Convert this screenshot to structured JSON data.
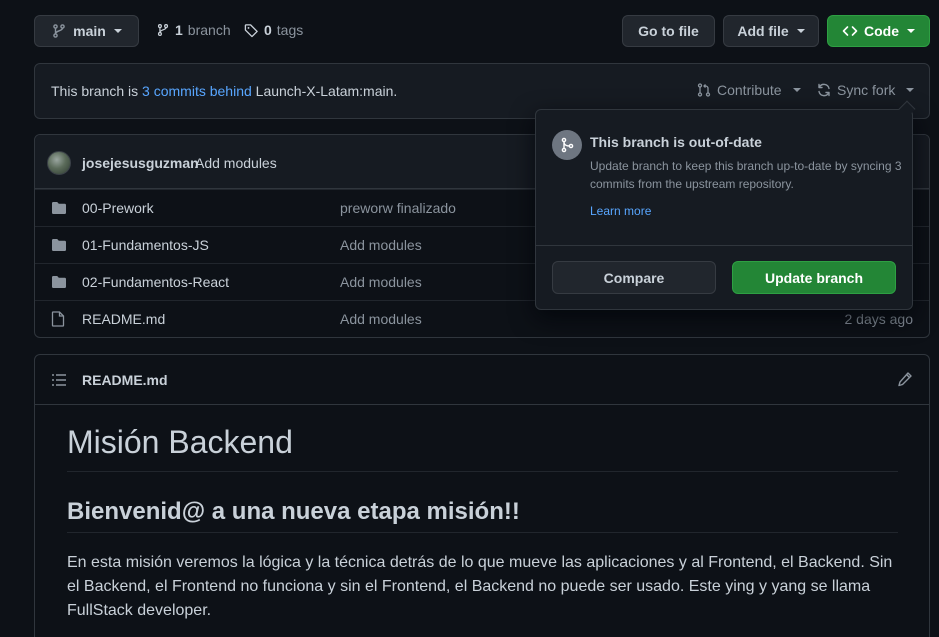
{
  "toolbar": {
    "branch_name": "main",
    "branch_count": "1",
    "branch_label": "branch",
    "tag_count": "0",
    "tag_label": "tags",
    "go_to_file": "Go to file",
    "add_file": "Add file",
    "code": "Code"
  },
  "banner": {
    "prefix": "This branch is",
    "link": "3 commits behind",
    "suffix": "Launch-X-Latam:main.",
    "contribute": "Contribute",
    "sync_fork": "Sync fork"
  },
  "commit": {
    "author": "josejesusguzman",
    "message": "Add modules"
  },
  "files": [
    {
      "type": "folder",
      "name": "00-Prework",
      "commit": "preworw finalizado",
      "date": ""
    },
    {
      "type": "folder",
      "name": "01-Fundamentos-JS",
      "commit": "Add modules",
      "date": ""
    },
    {
      "type": "folder",
      "name": "02-Fundamentos-React",
      "commit": "Add modules",
      "date": ""
    },
    {
      "type": "file",
      "name": "README.md",
      "commit": "Add modules",
      "date": "2 days ago"
    }
  ],
  "readme": {
    "header": "README.md",
    "h1": "Misión Backend",
    "h2": "Bienvenid@ a una nueva etapa misión!!",
    "paragraph": "En esta misión veremos la lógica y la técnica detrás de lo que mueve las aplicaciones y al Frontend, el Backend. Sin el Backend, el Frontend no funciona y sin el Frontend, el Backend no puede ser usado. Este ying y yang se llama FullStack developer."
  },
  "popover": {
    "title": "This branch is out-of-date",
    "description": "Update branch to keep this branch up-to-date by syncing 3 commits from the upstream repository.",
    "learn_more": "Learn more",
    "compare": "Compare",
    "update": "Update branch"
  },
  "colors": {
    "background": "#0d1117",
    "surface": "#161b22",
    "border": "#30363d",
    "link": "#58a6ff",
    "primary_green": "#238636",
    "muted_text": "#8b949e"
  }
}
